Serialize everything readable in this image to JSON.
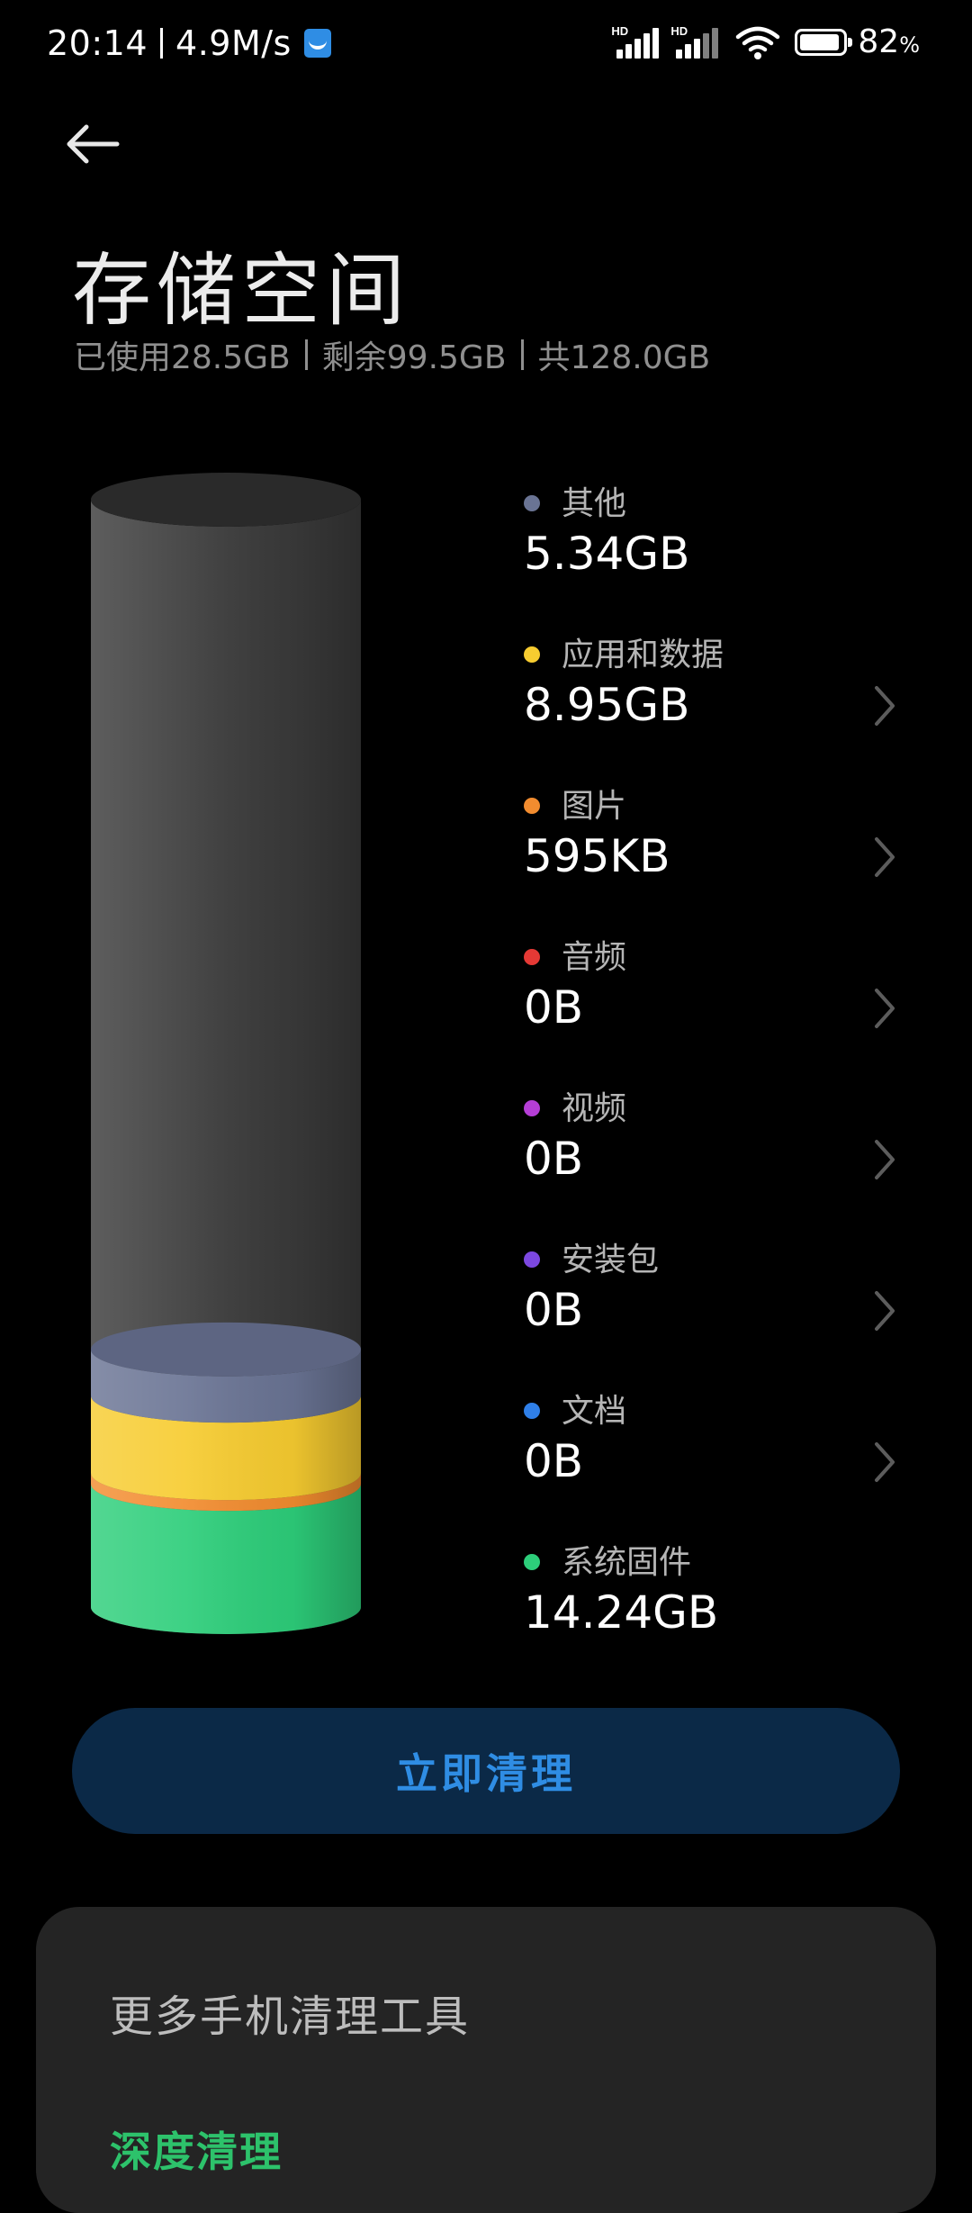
{
  "status_bar": {
    "time": "20:14",
    "speed": "4.9M/s",
    "signal1_label": "HD",
    "signal2_label": "HD",
    "battery_percent": "82",
    "battery_unit": "%",
    "icons": [
      "app-notification-icon",
      "signal-icon",
      "signal-icon",
      "wifi-icon",
      "battery-icon"
    ]
  },
  "header": {
    "back_icon": "arrow-left-icon",
    "title": "存储空间",
    "used": "已使用28.5GB",
    "free": "剩余99.5GB",
    "total": "共128.0GB"
  },
  "chart_data": {
    "type": "bar",
    "title": "",
    "unit": "GB",
    "total": 128.0,
    "used": 28.5,
    "segments_bottom_to_top": [
      {
        "name": "系统固件",
        "value": 14.24,
        "color": "#2dce7a"
      },
      {
        "name": "图片",
        "value": 0.000595,
        "color": "#f28c2f"
      },
      {
        "name": "应用和数据",
        "value": 8.95,
        "color": "#f7cc30"
      },
      {
        "name": "其他",
        "value": 5.34,
        "color": "#6a7494"
      }
    ],
    "free_color": "#3a3a3a"
  },
  "legend": [
    {
      "label": "其他",
      "value": "5.34GB",
      "color": "#6a7494",
      "has_chevron": false
    },
    {
      "label": "应用和数据",
      "value": "8.95GB",
      "color": "#f7cc30",
      "has_chevron": true
    },
    {
      "label": "图片",
      "value": "595KB",
      "color": "#f28c2f",
      "has_chevron": true
    },
    {
      "label": "音频",
      "value": "0B",
      "color": "#e53935",
      "has_chevron": true
    },
    {
      "label": "视频",
      "value": "0B",
      "color": "#b53ed6",
      "has_chevron": true
    },
    {
      "label": "安装包",
      "value": "0B",
      "color": "#7c48e0",
      "has_chevron": true
    },
    {
      "label": "文档",
      "value": "0B",
      "color": "#2f7fe8",
      "has_chevron": true
    },
    {
      "label": "系统固件",
      "value": "14.24GB",
      "color": "#2dce7a",
      "has_chevron": false
    }
  ],
  "actions": {
    "clean_now": "立即清理"
  },
  "tools": {
    "title": "更多手机清理工具",
    "deep_clean": "深度清理"
  }
}
